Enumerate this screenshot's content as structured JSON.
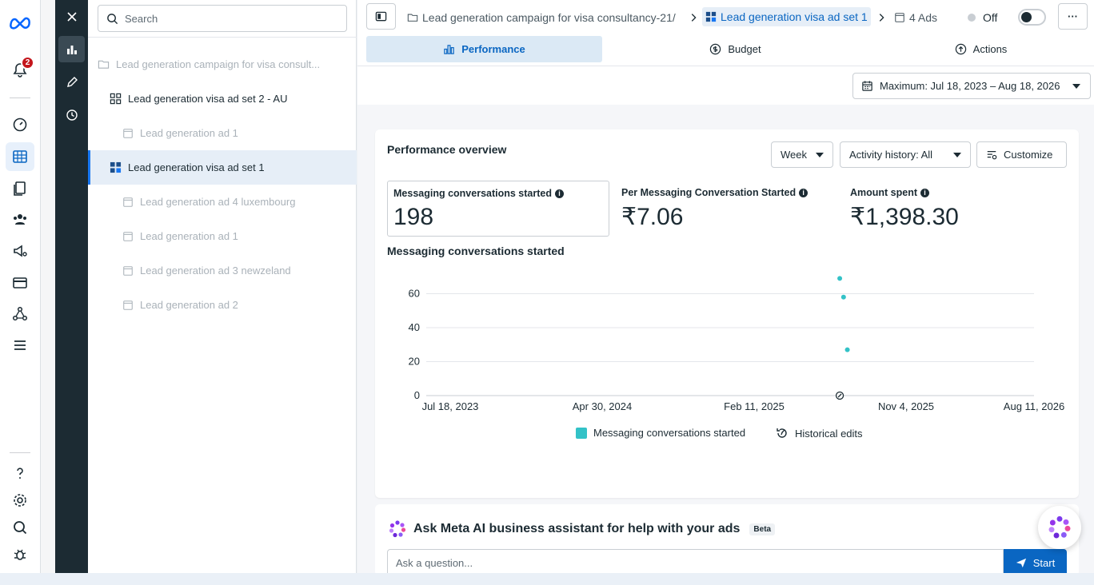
{
  "notifications": {
    "count": "2"
  },
  "tree": {
    "search_placeholder": "Search",
    "items": [
      {
        "label": "Lead generation campaign for visa consult..."
      },
      {
        "label": "Lead generation visa ad set 2 - AU"
      },
      {
        "label": "Lead generation ad 1"
      },
      {
        "label": "Lead generation visa ad set 1"
      },
      {
        "label": "Lead generation ad 4 luxembourg"
      },
      {
        "label": "Lead generation ad 1"
      },
      {
        "label": "Lead generation ad 3 newzeland"
      },
      {
        "label": "Lead generation ad 2"
      }
    ]
  },
  "header": {
    "breadcrumb_campaign": "Lead generation campaign for visa consultancy-21/",
    "breadcrumb_adset": "Lead generation visa ad set 1",
    "breadcrumb_ads": "4 Ads",
    "status_label": "Off",
    "more_label": "···"
  },
  "tabs": [
    {
      "label": "Performance"
    },
    {
      "label": "Budget"
    },
    {
      "label": "Actions"
    }
  ],
  "date_range": "Maximum: Jul 18, 2023 – Aug 18, 2026",
  "overview": {
    "title": "Performance overview",
    "week_label": "Week",
    "activity_label": "Activity history: All",
    "customize_label": "Customize",
    "metrics": [
      {
        "label": "Messaging conversations started",
        "value": "198"
      },
      {
        "label": "Per Messaging Conversation Started",
        "value": "₹7.06"
      },
      {
        "label": "Amount spent",
        "value": "₹1,398.30"
      }
    ],
    "chart_title": "Messaging conversations started",
    "legend_series": "Messaging conversations started",
    "legend_edits": "Historical edits"
  },
  "chart_data": {
    "type": "scatter",
    "title": "Messaging conversations started",
    "x_tick_labels": [
      "Jul 18, 2023",
      "Apr 30, 2024",
      "Feb 11, 2025",
      "Nov 4, 2025",
      "Aug 11, 2026"
    ],
    "x_range": [
      "2023-07-18",
      "2026-08-11"
    ],
    "y_ticks": [
      0,
      20,
      40,
      60
    ],
    "ylim": [
      0,
      60
    ],
    "series": [
      {
        "name": "Messaging conversations started",
        "color": "#33c2c7",
        "points": [
          {
            "x": "2025-08-18",
            "y": 69
          },
          {
            "x": "2025-08-25",
            "y": 58
          },
          {
            "x": "2025-09-01",
            "y": 27
          }
        ]
      }
    ],
    "historical_edit_markers": [
      {
        "x": "2025-08-18"
      }
    ],
    "grid": "horizontal",
    "legend": "bottom-center"
  },
  "ai": {
    "title": "Ask Meta AI business assistant for help with your ads",
    "beta": "Beta",
    "placeholder": "Ask a question...",
    "start_label": "Start"
  },
  "colors": {
    "accent": "#0a66c2",
    "series": "#33c2c7",
    "dark": "#1c2b33"
  }
}
